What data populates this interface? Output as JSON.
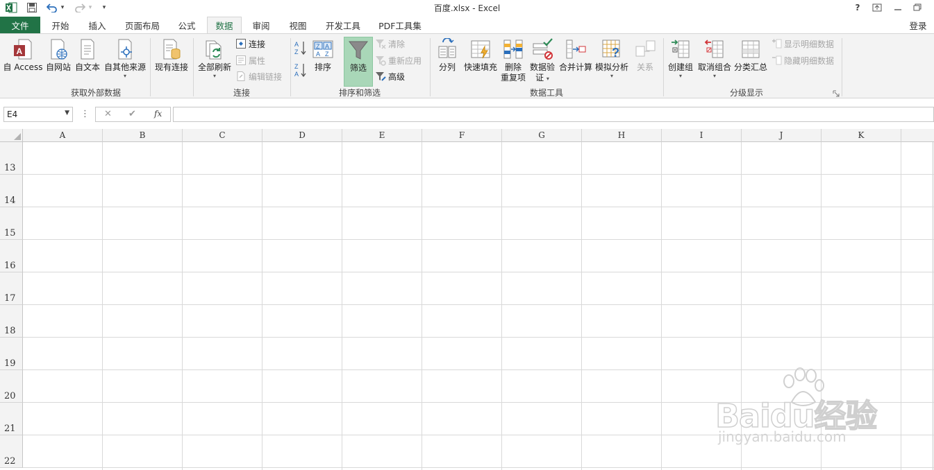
{
  "title_bar": {
    "title": "百度.xlsx - Excel",
    "help": "?",
    "undo_caret": "▾",
    "redo_caret": "▾",
    "qat_more": "▾"
  },
  "tabs": [
    {
      "label": "文件"
    },
    {
      "label": "开始"
    },
    {
      "label": "插入"
    },
    {
      "label": "页面布局"
    },
    {
      "label": "公式"
    },
    {
      "label": "数据"
    },
    {
      "label": "审阅"
    },
    {
      "label": "视图"
    },
    {
      "label": "开发工具"
    },
    {
      "label": "PDF工具集"
    }
  ],
  "account": {
    "label": "登录"
  },
  "ribbon": {
    "get_external": {
      "group_label": "获取外部数据",
      "access": "自 Access",
      "web": "自网站",
      "text": "自文本",
      "other": "自其他来源",
      "existing": "现有连接"
    },
    "connections": {
      "group_label": "连接",
      "refresh_all": "全部刷新",
      "connections": "连接",
      "properties": "属性",
      "edit_links": "编辑链接"
    },
    "sort_filter": {
      "group_label": "排序和筛选",
      "sort": "排序",
      "filter": "筛选",
      "clear": "清除",
      "reapply": "重新应用",
      "advanced": "高级"
    },
    "data_tools": {
      "group_label": "数据工具",
      "text_to_columns": "分列",
      "flash_fill": "快速填充",
      "remove_dup_1": "删除",
      "remove_dup_2": "重复项",
      "validation_1": "数据验",
      "validation_2": "证",
      "consolidate": "合并计算",
      "what_if": "模拟分析",
      "relationships": "关系"
    },
    "outline": {
      "group_label": "分级显示",
      "group": "创建组",
      "ungroup": "取消组合",
      "subtotal": "分类汇总",
      "show_detail": "显示明细数据",
      "hide_detail": "隐藏明细数据"
    }
  },
  "formula_bar": {
    "name_box": "E4",
    "more": "⋮",
    "cancel": "✕",
    "enter": "✔",
    "fx": "fx",
    "formula": ""
  },
  "sheet": {
    "columns": [
      "A",
      "B",
      "C",
      "D",
      "E",
      "F",
      "G",
      "H",
      "I",
      "J",
      "K"
    ],
    "rows": [
      "13",
      "14",
      "15",
      "16",
      "17",
      "18",
      "19",
      "20",
      "21",
      "22"
    ]
  },
  "watermark": {
    "brand": "Baidu经验",
    "url": "jingyan.baidu.com"
  },
  "colors": {
    "excel_green": "#217346",
    "filter_active": "#a9d7b8"
  }
}
